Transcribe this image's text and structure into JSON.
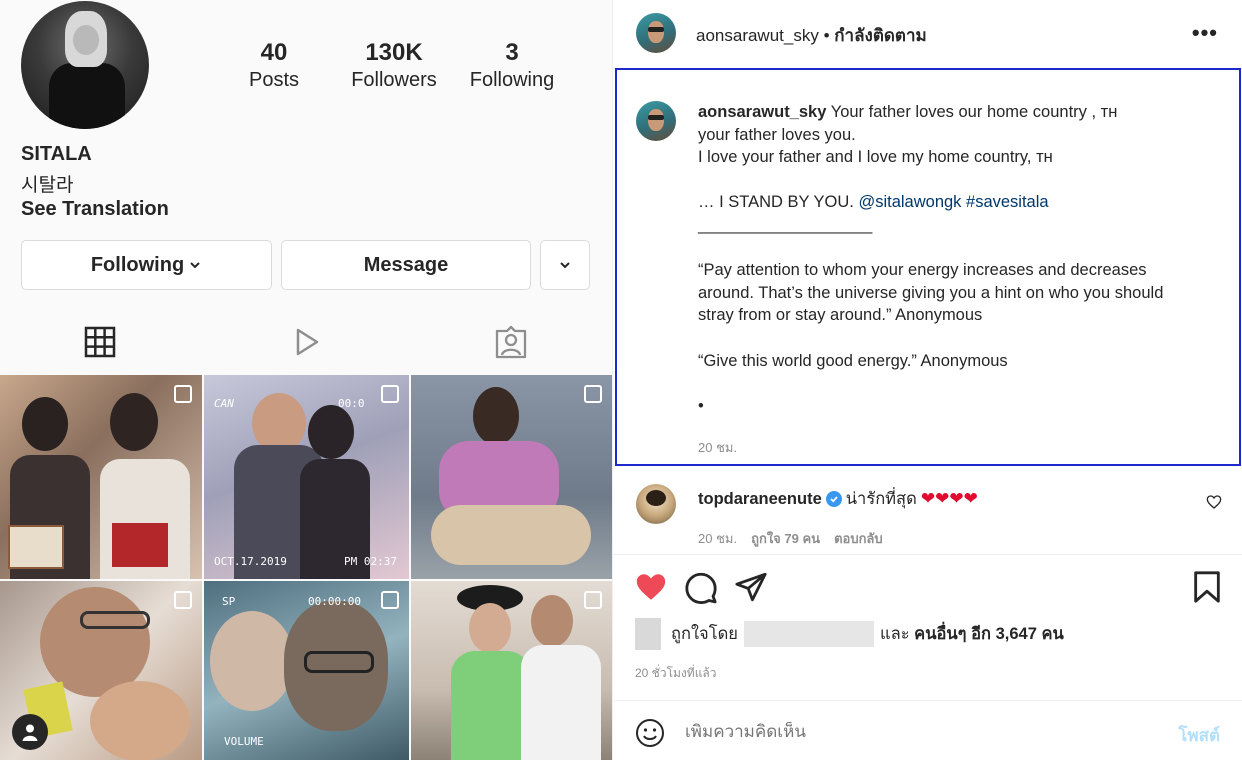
{
  "profile": {
    "stats": [
      {
        "num": "40",
        "label": "Posts"
      },
      {
        "num": "130K",
        "label": "Followers"
      },
      {
        "num": "3",
        "label": "Following"
      }
    ],
    "name": "SITALA",
    "korean_name": "시탈라",
    "see_translation": "See Translation",
    "buttons": {
      "following": "Following",
      "message": "Message"
    }
  },
  "grid": {
    "overlay_texts": {
      "p2_top_left": "CAN",
      "p2_top_right": "00:0",
      "p2_date": "OCT.17.2019",
      "p2_time": "PM 02:37",
      "p5_top_left": "SP",
      "p5_top_right": "00:00:00",
      "p5_bottom": "VOLUME"
    }
  },
  "post": {
    "author": "aonsarawut_sky",
    "follow_status": "กำลังติดตาม",
    "more": "•••",
    "caption_lines": [
      "Your father loves our home country , ᴛʜ",
      "your father loves you.",
      "I love your father and I love my home country, ᴛʜ",
      "",
      "… I STAND BY YOU.",
      "___________________",
      "",
      "“Pay attention to whom your energy increases and decreases",
      "around. That’s the universe giving you a hint on who you should",
      "stray from or stay around.” Anonymous",
      "",
      "“Give this world good energy.” Anonymous",
      "",
      "•"
    ],
    "mention": "@sitalawongk",
    "hashtag": "#savesitala",
    "caption_time": "20 ชม.",
    "comment": {
      "user": "topdaraneenute",
      "text": "น่ารักที่สุด",
      "hearts": "❤❤❤❤",
      "time": "20 ชม.",
      "likes": "ถูกใจ 79 คน",
      "reply": "ตอบกลับ"
    },
    "liked_by_prefix": "ถูกใจโดย",
    "liked_by_and": "และ",
    "liked_by_others": "คนอื่นๆ อีก 3,647 คน",
    "posted_ago": "20 ชั่วโมงที่แล้ว",
    "comment_placeholder": "เพิ่มความคิดเห็น",
    "post_button": "โพสต์"
  },
  "colors": {
    "highlight_border": "#1c28c9",
    "like_red": "#ed4956",
    "link_blue": "#00376b",
    "verified_blue": "#3897f0",
    "post_disabled": "#b2dffc"
  }
}
